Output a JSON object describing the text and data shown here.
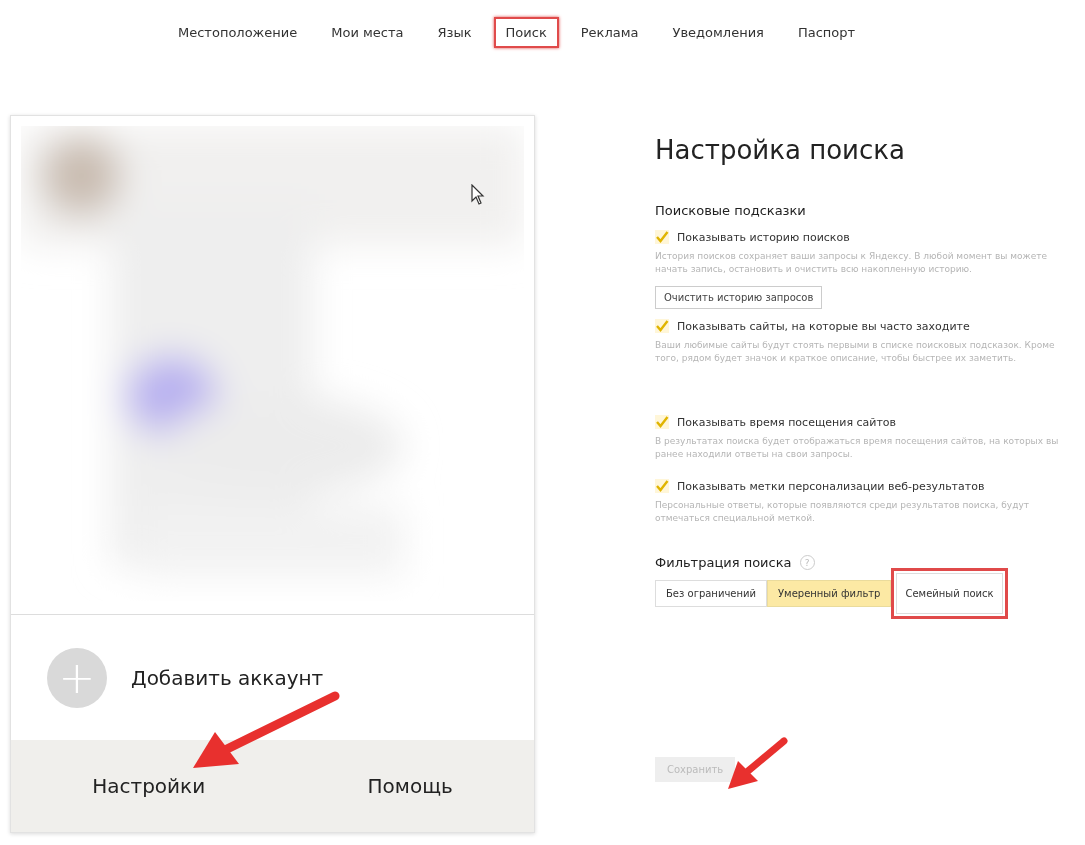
{
  "nav": [
    {
      "label": "Местоположение",
      "highlighted": false
    },
    {
      "label": "Мои места",
      "highlighted": false
    },
    {
      "label": "Язык",
      "highlighted": false
    },
    {
      "label": "Поиск",
      "highlighted": true
    },
    {
      "label": "Реклама",
      "highlighted": false
    },
    {
      "label": "Уведомления",
      "highlighted": false
    },
    {
      "label": "Паспорт",
      "highlighted": false
    }
  ],
  "account_card": {
    "add_account": {
      "icon": "+",
      "label": "Добавить аккаунт"
    },
    "footer": [
      {
        "label": "Настройки"
      },
      {
        "label": "Помощь"
      }
    ]
  },
  "search_settings": {
    "title": "Настройка поиска",
    "suggestions_heading": "Поисковые подсказки",
    "options": [
      {
        "label": "Показывать историю поисков",
        "checked": true,
        "description": "История поисков сохраняет ваши запросы к Яндексу. В любой момент вы можете начать запись, остановить и очистить всю накопленную историю.",
        "button": "Очистить историю запросов"
      },
      {
        "label": "Показывать сайты, на которые вы часто заходите",
        "checked": true,
        "description": "Ваши любимые сайты будут стоять первыми в списке поисковых подсказок. Кроме того, рядом будет значок и краткое описание, чтобы быстрее их заметить."
      },
      {
        "label": "Показывать время посещения сайтов",
        "checked": true,
        "description": "В результатах поиска будет отображаться время посещения сайтов, на которых вы ранее находили ответы на свои запросы."
      },
      {
        "label": "Показывать метки персонализации веб-результатов",
        "checked": true,
        "description": "Персональные ответы, которые появляются среди результатов поиска, будут отмечаться специальной меткой."
      }
    ],
    "filter_heading": "Фильтрация поиска",
    "filter_help": "?",
    "filter_options": [
      {
        "label": "Без ограничений",
        "selected": false,
        "highlighted": false
      },
      {
        "label": "Умеренный фильтр",
        "selected": true,
        "highlighted": false
      },
      {
        "label": "Семейный поиск",
        "selected": false,
        "highlighted": true
      }
    ],
    "save_button": {
      "label": "Сохранить",
      "disabled": true
    }
  },
  "annotations": [
    {
      "kind": "arrow"
    },
    {
      "kind": "arrow"
    }
  ]
}
